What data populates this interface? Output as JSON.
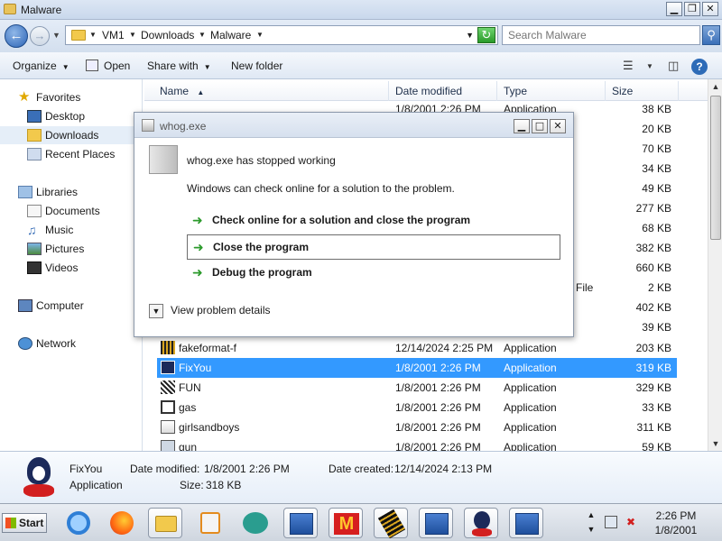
{
  "window": {
    "title": "Malware",
    "min_glyph": "▁",
    "max_glyph": "❐",
    "close_glyph": "✕"
  },
  "address": {
    "crumbs": [
      "VM1",
      "Downloads",
      "Malware"
    ],
    "search_placeholder": "Search Malware"
  },
  "toolbar": {
    "organize": "Organize",
    "open": "Open",
    "share_with": "Share with",
    "new_folder": "New folder"
  },
  "navpane": {
    "favorites": "Favorites",
    "desktop": "Desktop",
    "downloads": "Downloads",
    "recent_places": "Recent Places",
    "libraries": "Libraries",
    "documents": "Documents",
    "music": "Music",
    "pictures": "Pictures",
    "videos": "Videos",
    "computer": "Computer",
    "network": "Network"
  },
  "columns": {
    "name": "Name",
    "date_modified": "Date modified",
    "type": "Type",
    "size": "Size"
  },
  "hidden_rows": {
    "partial_date": "1/8/2001 2:26 PM",
    "partial_type": "Application",
    "sizes": [
      "38 KB",
      "20 KB",
      "70 KB",
      "34 KB",
      "49 KB",
      "277 KB",
      "68 KB",
      "382 KB",
      "660 KB",
      "2 KB",
      "402 KB",
      "39 KB"
    ],
    "file_type_fragment": "File"
  },
  "files": [
    {
      "name": "fakeformat-f",
      "date": "12/14/2024 2:25 PM",
      "type": "Application",
      "size": "203 KB",
      "selected": false
    },
    {
      "name": "FixYou",
      "date": "1/8/2001 2:26 PM",
      "type": "Application",
      "size": "319 KB",
      "selected": true
    },
    {
      "name": "FUN",
      "date": "1/8/2001 2:26 PM",
      "type": "Application",
      "size": "329 KB",
      "selected": false
    },
    {
      "name": "gas",
      "date": "1/8/2001 2:26 PM",
      "type": "Application",
      "size": "33 KB",
      "selected": false
    },
    {
      "name": "girlsandboys",
      "date": "1/8/2001 2:26 PM",
      "type": "Application",
      "size": "311 KB",
      "selected": false
    },
    {
      "name": "gun",
      "date": "1/8/2001 2:26 PM",
      "type": "Application",
      "size": "59 KB",
      "selected": false
    }
  ],
  "details": {
    "name": "FixYou",
    "type": "Application",
    "date_modified_label": "Date modified:",
    "date_modified": "1/8/2001 2:26 PM",
    "date_created_label": "Date created:",
    "date_created": "12/14/2024 2:13 PM",
    "size_label": "Size:",
    "size": "318 KB"
  },
  "dialog": {
    "title": "whog.exe",
    "heading": "whog.exe has stopped working",
    "message": "Windows can check online for a solution to the problem.",
    "opt_check_online": "Check online for a solution and close the program",
    "opt_close": "Close the program",
    "opt_debug": "Debug the program",
    "view_details": "View problem details"
  },
  "taskbar": {
    "start": "Start",
    "time": "2:26 PM",
    "date": "1/8/2001"
  },
  "colors": {
    "selection": "#3399ff",
    "option_arrow": "#2b9a2b"
  }
}
